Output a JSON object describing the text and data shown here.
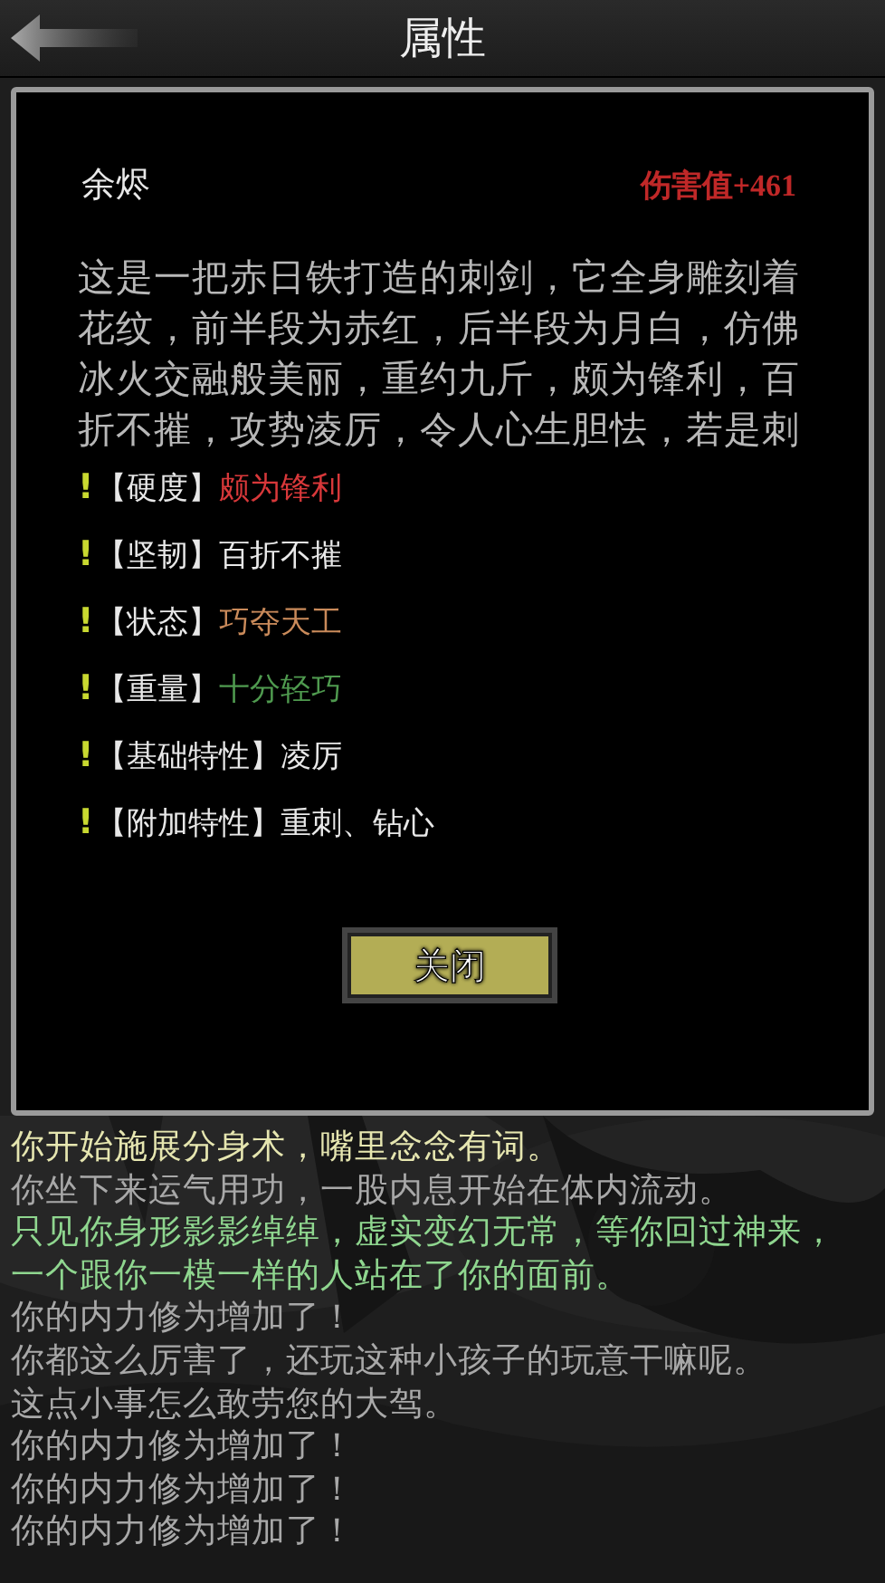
{
  "header": {
    "title": "属性"
  },
  "item": {
    "name": "余烬",
    "damage": "伤害值+461",
    "description_lines": [
      "这是一把赤日铁打造的刺剑，它全身雕刻着",
      "花纹，前半段为赤红，后半段为月白，仿佛",
      "冰火交融般美丽，重约九斤，颇为锋利，百",
      "折不摧，攻势凌厉，令人心生胆怯，若是刺"
    ],
    "attributes": [
      {
        "mark": "!",
        "label": "【硬度】",
        "value": "颇为锋利",
        "color": "#d8383a"
      },
      {
        "mark": "!",
        "label": "【坚韧】",
        "value": "百折不摧",
        "color": "#e8e8e8"
      },
      {
        "mark": "!",
        "label": "【状态】",
        "value": "巧夺天工",
        "color": "#c98a5a"
      },
      {
        "mark": "!",
        "label": "【重量】",
        "value": "十分轻巧",
        "color": "#4f9a4f"
      },
      {
        "mark": "!",
        "label": "【基础特性】",
        "value": "凌厉",
        "color": "#e8e8e8"
      },
      {
        "mark": "!",
        "label": "【附加特性】",
        "value": "重刺、钻心",
        "color": "#e8e8e8"
      }
    ],
    "close_button": "关闭"
  },
  "log": [
    {
      "text": "你开始施展分身术，嘴里念念有词。",
      "color": "#e6e6b0"
    },
    {
      "text": "你坐下来运气用功，一股内息开始在体内流动。",
      "color": "#a8a8a8"
    },
    {
      "text": "只见你身形影影绰绰，虚实变幻无常，等你回过神来，",
      "color": "#8fd68f"
    },
    {
      "text": "一个跟你一模一样的人站在了你的面前。",
      "color": "#8fd68f"
    },
    {
      "text": "你的内力修为增加了！",
      "color": "#a8a8a8"
    },
    {
      "text": "你都这么厉害了，还玩这种小孩子的玩意干嘛呢。",
      "color": "#a8a8a8"
    },
    {
      "text": "这点小事怎么敢劳您的大驾。",
      "color": "#a8a8a8"
    },
    {
      "text": "你的内力修为增加了！",
      "color": "#a8a8a8"
    },
    {
      "text": "你的内力修为增加了！",
      "color": "#a8a8a8"
    },
    {
      "text": "你的内力修为增加了！",
      "color": "#a8a8a8"
    }
  ]
}
